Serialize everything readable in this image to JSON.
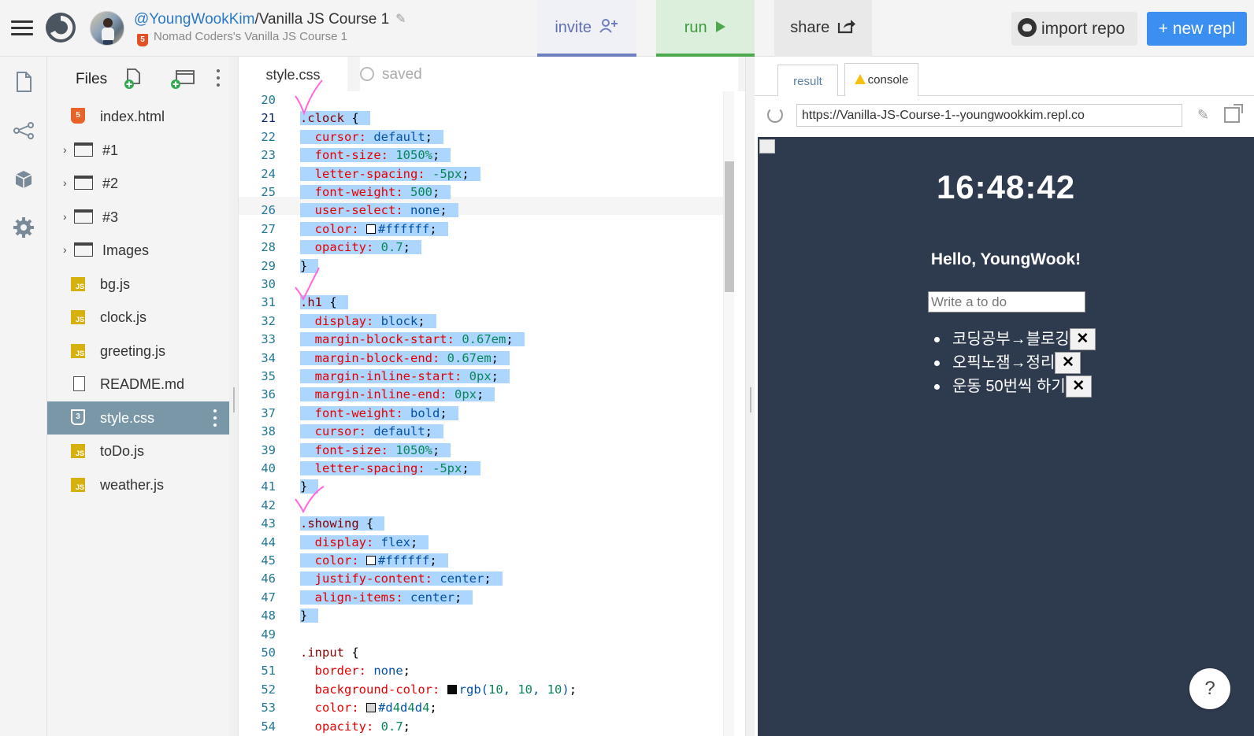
{
  "header": {
    "owner": "@YoungWookKim",
    "separator": "/",
    "repl_name": "Vanilla JS Course 1",
    "subtitle": "Nomad Coders's Vanilla JS Course 1",
    "invite_label": "invite",
    "run_label": "run",
    "share_label": "share",
    "import_label": "import repo",
    "new_repl_label": "+ new repl"
  },
  "files": {
    "title": "Files",
    "items": [
      {
        "name": "index.html",
        "type": "html",
        "folder": false
      },
      {
        "name": "#1",
        "type": "folder",
        "folder": true
      },
      {
        "name": "#2",
        "type": "folder",
        "folder": true
      },
      {
        "name": "#3",
        "type": "folder",
        "folder": true
      },
      {
        "name": "Images",
        "type": "folder",
        "folder": true
      },
      {
        "name": "bg.js",
        "type": "js",
        "folder": false
      },
      {
        "name": "clock.js",
        "type": "js",
        "folder": false
      },
      {
        "name": "greeting.js",
        "type": "js",
        "folder": false
      },
      {
        "name": "README.md",
        "type": "md",
        "folder": false
      },
      {
        "name": "style.css",
        "type": "css",
        "folder": false,
        "selected": true
      },
      {
        "name": "toDo.js",
        "type": "js",
        "folder": false
      },
      {
        "name": "weather.js",
        "type": "js",
        "folder": false
      }
    ]
  },
  "editor": {
    "tab_label": "style.css",
    "saved_label": "saved",
    "active_line": 21,
    "lines": [
      {
        "n": 20,
        "t": "",
        "sel": false
      },
      {
        "n": 21,
        "t": ".clock {",
        "sel": true
      },
      {
        "n": 22,
        "t": "  cursor: default;",
        "sel": true
      },
      {
        "n": 23,
        "t": "  font-size: 1050%;",
        "sel": true
      },
      {
        "n": 24,
        "t": "  letter-spacing: -5px;",
        "sel": true
      },
      {
        "n": 25,
        "t": "  font-weight: 500;",
        "sel": true
      },
      {
        "n": 26,
        "t": "  user-select: none;",
        "sel": true
      },
      {
        "n": 27,
        "t": "  color: #ffffff;",
        "sel": true,
        "swatch": "#ffffff"
      },
      {
        "n": 28,
        "t": "  opacity: 0.7;",
        "sel": true
      },
      {
        "n": 29,
        "t": "}",
        "sel": true
      },
      {
        "n": 30,
        "t": "",
        "sel": false
      },
      {
        "n": 31,
        "t": ".h1 {",
        "sel": true
      },
      {
        "n": 32,
        "t": "  display: block;",
        "sel": true
      },
      {
        "n": 33,
        "t": "  margin-block-start: 0.67em;",
        "sel": true
      },
      {
        "n": 34,
        "t": "  margin-block-end: 0.67em;",
        "sel": true
      },
      {
        "n": 35,
        "t": "  margin-inline-start: 0px;",
        "sel": true
      },
      {
        "n": 36,
        "t": "  margin-inline-end: 0px;",
        "sel": true
      },
      {
        "n": 37,
        "t": "  font-weight: bold;",
        "sel": true
      },
      {
        "n": 38,
        "t": "  cursor: default;",
        "sel": true
      },
      {
        "n": 39,
        "t": "  font-size: 1050%;",
        "sel": true
      },
      {
        "n": 40,
        "t": "  letter-spacing: -5px;",
        "sel": true
      },
      {
        "n": 41,
        "t": "}",
        "sel": true
      },
      {
        "n": 42,
        "t": "",
        "sel": false
      },
      {
        "n": 43,
        "t": ".showing {",
        "sel": true
      },
      {
        "n": 44,
        "t": "  display: flex;",
        "sel": true
      },
      {
        "n": 45,
        "t": "  color: #ffffff;",
        "sel": true,
        "swatch": "#ffffff"
      },
      {
        "n": 46,
        "t": "  justify-content: center;",
        "sel": true
      },
      {
        "n": 47,
        "t": "  align-items: center;",
        "sel": true
      },
      {
        "n": 48,
        "t": "}",
        "sel": true
      },
      {
        "n": 49,
        "t": "",
        "sel": false
      },
      {
        "n": 50,
        "t": ".input {",
        "sel": false
      },
      {
        "n": 51,
        "t": "  border: none;",
        "sel": false
      },
      {
        "n": 52,
        "t": "  background-color: rgb(10, 10, 10);",
        "sel": false,
        "swatch": "#0a0a0a"
      },
      {
        "n": 53,
        "t": "  color: #d4d4d4;",
        "sel": false,
        "swatch": "#d4d4d4"
      },
      {
        "n": 54,
        "t": "  opacity: 0.7;",
        "sel": false
      }
    ]
  },
  "output": {
    "result_tab": "result",
    "console_tab": "console",
    "url": "https://Vanilla-JS-Course-1--youngwookkim.repl.co",
    "clock": "16:48:42",
    "greeting": "Hello, YoungWook!",
    "todo_placeholder": "Write a to do",
    "todos": [
      "코딩공부→블로깅",
      "오픽노잼→정리",
      "운동 50번씩 하기"
    ],
    "delete_label": "✕",
    "help_label": "?"
  },
  "colors": {
    "accent_blue": "#3b8ff0",
    "run_green": "#4ca84c",
    "preview_bg": "#2e3b4e",
    "selection": "#add6ff",
    "selected_file": "#7a97a8",
    "annotation_pink": "#ff66e0"
  }
}
